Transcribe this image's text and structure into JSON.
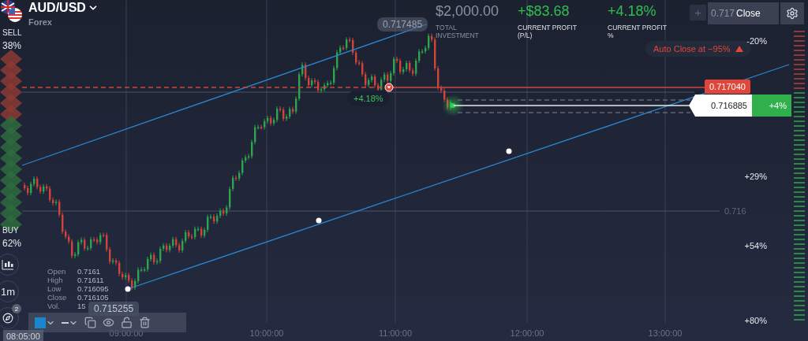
{
  "asset": {
    "name": "AUD/USD",
    "category": "Forex"
  },
  "sentiment": {
    "sell_label": "SELL",
    "sell_value": "38%",
    "buy_label": "BUY",
    "buy_value": "62%",
    "level": 0.38
  },
  "stats": [
    {
      "value": "$2,000.00",
      "label": "TOTAL INVESTMENT",
      "kind": "neutral"
    },
    {
      "value": "+$83.68",
      "label": "CURRENT PROFIT (P/L)",
      "kind": "positive"
    },
    {
      "value": "+4.18%",
      "label": "CURRENT PROFIT %",
      "kind": "positive"
    }
  ],
  "trade_controls": {
    "step": "+",
    "amount": "0.717",
    "close": "Close"
  },
  "auto_close": "Auto Close at −95%",
  "channel_price": "0.717485",
  "open_price": "0.717040",
  "current": {
    "price": "0.716885",
    "profit": "+4%"
  },
  "trade_badge": "+4.18%",
  "grid_price": "0.716",
  "profit_scale": [
    "-20%",
    "+29%",
    "+54%",
    "+80%"
  ],
  "ohlc": [
    {
      "label": "Open",
      "value": "0.7161"
    },
    {
      "label": "High",
      "value": "0.71611"
    },
    {
      "label": "Low",
      "value": "0.716095"
    },
    {
      "label": "Close",
      "value": "0.716105"
    },
    {
      "label": "Vol.",
      "value": "15"
    }
  ],
  "anchor_price": "0.715255",
  "side_tools": [
    {
      "kind": "chart-type"
    },
    {
      "kind": "timeframe",
      "label": "1m"
    },
    {
      "kind": "drawing",
      "badge": "2"
    }
  ],
  "drawing_toolbar": {
    "color": "#1a86d0"
  },
  "crosshair_time": "08:05:00",
  "time_axis": [
    "09:00:00",
    "10:00:00",
    "11:00:00",
    "12:00:00",
    "13:00:00"
  ]
}
